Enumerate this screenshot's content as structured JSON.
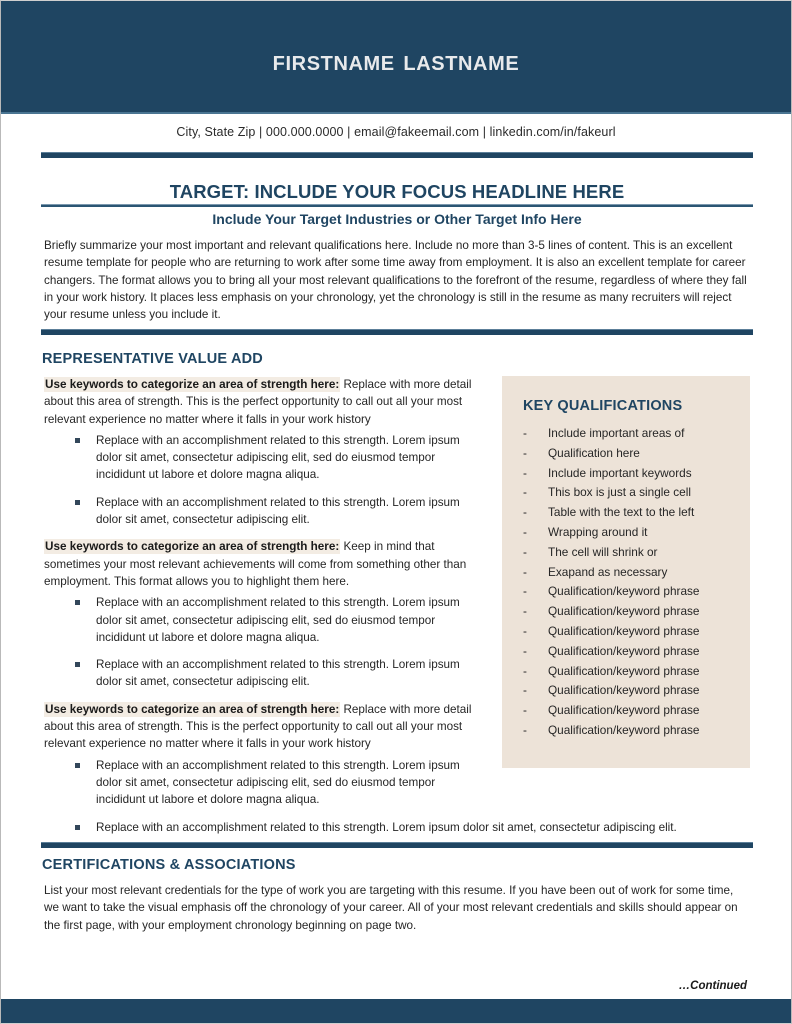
{
  "document": {
    "type": "resume-template",
    "colors": {
      "navy": "#1f4562",
      "beige_box": "#ede3d8",
      "highlight": "#f3ece3",
      "body_text": "#262626"
    }
  },
  "header": {
    "name": "Firstname Lastname"
  },
  "contact": {
    "line": "City, State Zip | 000.000.0000 | email@fakeemail.com | linkedin.com/in/fakeurl"
  },
  "target": {
    "headline": "TARGET: INCLUDE YOUR FOCUS HEADLINE HERE",
    "subheadline": "Include Your Target Industries or Other Target Info Here",
    "summary": "Briefly summarize your most important and relevant qualifications here. Include no more than 3-5 lines of content. This is an excellent resume template for people who are returning to work after some time away from employment. It is also an excellent template for career changers. The format allows you to bring all your most relevant qualifications to the forefront of the resume, regardless of where they fall in your work history. It places less emphasis on your chronology, yet the chronology is still in the resume as many recruiters will reject your resume unless you include it."
  },
  "value_add": {
    "heading": "REPRESENTATIVE VALUE ADD",
    "blocks": [
      {
        "keyword_lead": "Use keywords to categorize an area of strength here:",
        "detail": " Replace with more detail about this area of strength. This is the perfect opportunity to call out all your most relevant experience no matter where it falls in your work history",
        "bullets": [
          "Replace with an accomplishment related to this strength. Lorem ipsum dolor sit amet, consectetur adipiscing elit, sed do eiusmod tempor incididunt ut labore et dolore magna aliqua.",
          "Replace with an accomplishment related to this strength. Lorem ipsum dolor sit amet, consectetur adipiscing elit."
        ]
      },
      {
        "keyword_lead": "Use keywords to categorize an area of strength here:",
        "detail": " Keep in mind that sometimes your most relevant achievements will come from something other than employment. This format allows you to highlight them here.",
        "bullets": [
          "Replace with an accomplishment related to this strength. Lorem ipsum dolor sit amet, consectetur adipiscing elit, sed do eiusmod tempor incididunt ut labore et dolore magna aliqua.",
          "Replace with an accomplishment related to this strength. Lorem ipsum dolor sit amet, consectetur adipiscing elit."
        ]
      },
      {
        "keyword_lead": "Use keywords to categorize an area of strength here:",
        "detail": " Replace with more detail about this area of strength. This is the perfect opportunity to call out all your most relevant experience no matter where it falls in your work history",
        "bullets": [
          "Replace with an accomplishment related to this strength. Lorem ipsum dolor sit amet, consectetur adipiscing elit, sed do eiusmod tempor incididunt ut labore et dolore magna aliqua.",
          "Replace with an accomplishment related to this strength. Lorem ipsum dolor sit amet, consectetur adipiscing elit."
        ]
      }
    ]
  },
  "key_qualifications": {
    "title": "KEY QUALIFICATIONS",
    "dash": "-",
    "items": [
      "Include important areas of",
      "Qualification here",
      "Include important keywords",
      "This box is just a single cell",
      "Table with the text to the left",
      "Wrapping around it",
      "The cell will shrink or",
      "Exapand as necessary",
      "Qualification/keyword phrase",
      "Qualification/keyword phrase",
      "Qualification/keyword phrase",
      "Qualification/keyword phrase",
      "Qualification/keyword phrase",
      "Qualification/keyword phrase",
      "Qualification/keyword phrase",
      "Qualification/keyword phrase"
    ]
  },
  "certifications": {
    "heading": "CERTIFICATIONS & ASSOCIATIONS",
    "paragraph": "List your most relevant credentials for the type of work you are targeting with this resume. If you have been out of work for some time, we want to take the visual emphasis off the chronology of your career. All of your most relevant credentials and skills should appear on the first page, with your employment chronology beginning on page two."
  },
  "footer": {
    "continued": "…Continued"
  }
}
